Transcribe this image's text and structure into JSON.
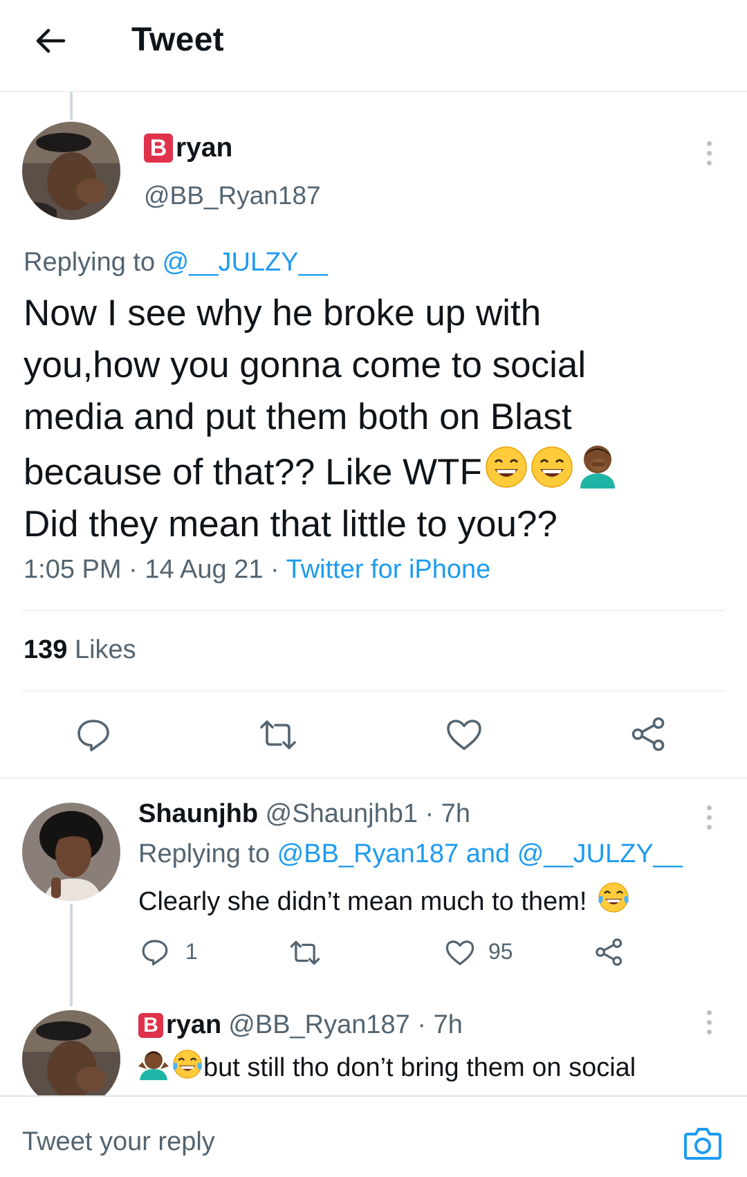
{
  "header": {
    "title": "Tweet"
  },
  "main_tweet": {
    "display_name_badge": "B",
    "display_name_rest": "ryan",
    "handle": "@BB_Ryan187",
    "replying_prefix": "Replying to ",
    "replying_to": "@__JULZY__",
    "body_lines": [
      "Now I see why he broke up with",
      "you,how you gonna come to social",
      "media and put them both on Blast",
      "because of that?? Like WTF",
      "Did they mean that little to you??"
    ],
    "time": "1:05 PM",
    "date": "14 Aug 21",
    "source": "Twitter for iPhone",
    "sep": " · ",
    "likes_count": "139",
    "likes_label": " Likes"
  },
  "reply1": {
    "name": "Shaunjhb",
    "handle_time": " @Shaunjhb1 · 7h",
    "replying_prefix": "Replying to ",
    "replying_to": "@BB_Ryan187 and @__JULZY__",
    "body": "Clearly she didn’t mean much to them! ",
    "reply_count": "1",
    "like_count": "95"
  },
  "reply2": {
    "display_name_badge": "B",
    "display_name_rest": "ryan",
    "handle_time": "@BB_Ryan187 · 7h",
    "body": "but still tho don’t bring them on social"
  },
  "composer": {
    "placeholder": "Tweet your reply"
  },
  "colors": {
    "accent": "#1d9bf0",
    "muted": "#536471",
    "badge_red": "#e0324b"
  }
}
